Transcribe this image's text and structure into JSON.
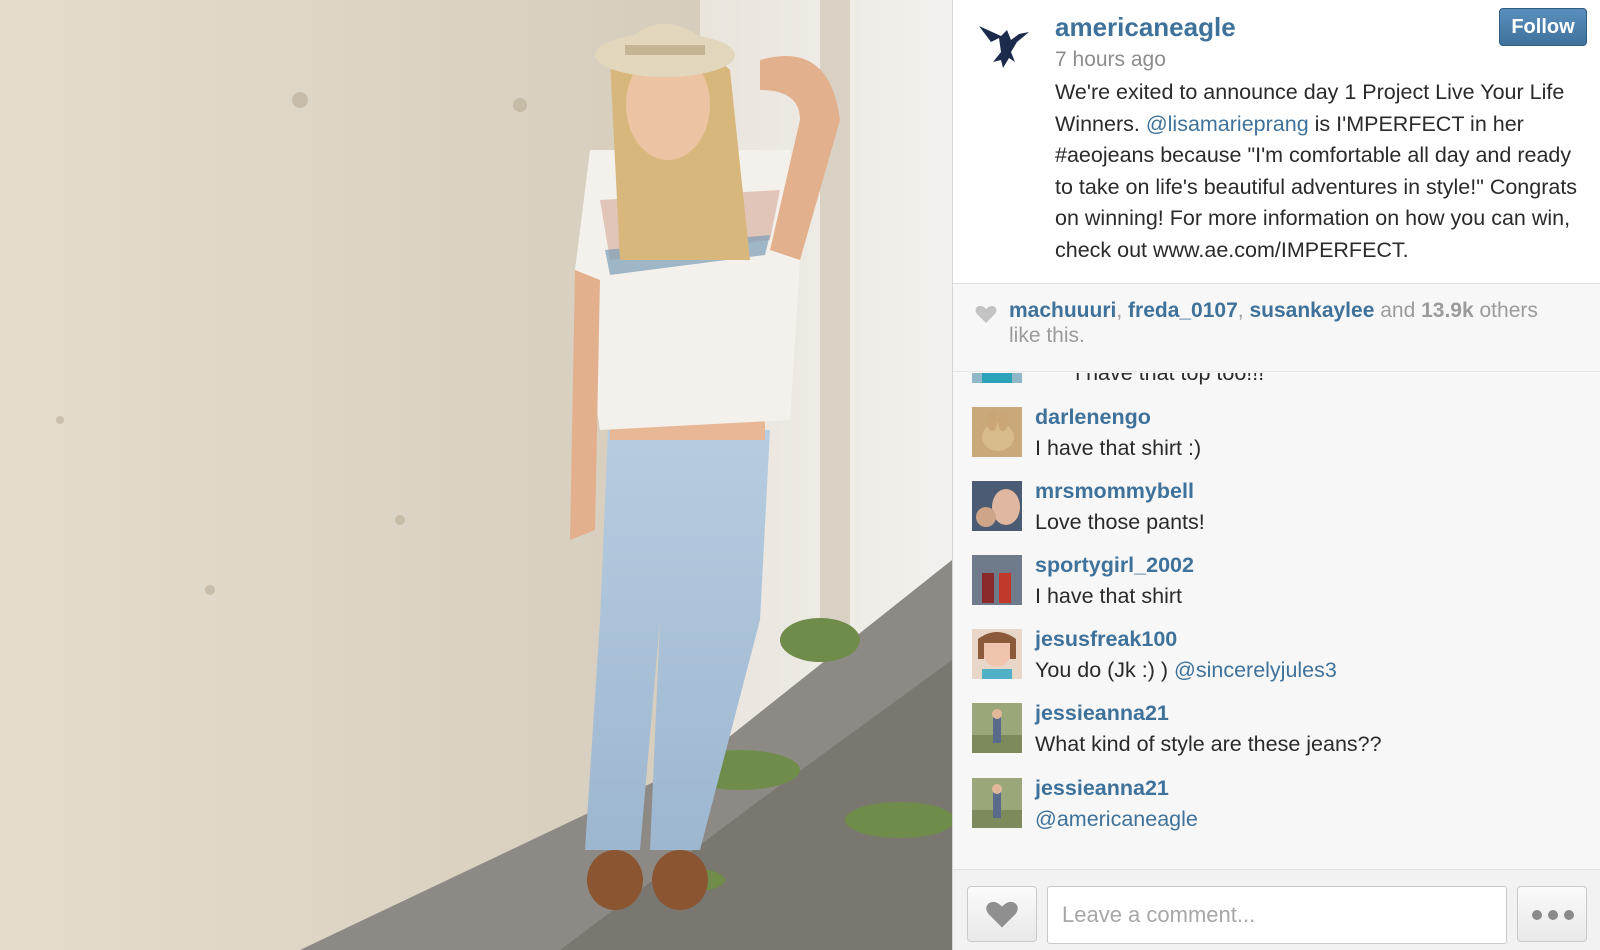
{
  "photo": {
    "alt_subject": "woman-in-jeans-against-wall"
  },
  "post": {
    "author": "americaneagle",
    "follow_label": "Follow",
    "time": "7 hours ago",
    "caption_parts": {
      "before": "We're exited to announce day 1 Project Live Your Life Winners. ",
      "mention": "@lisamarieprang",
      "after": " is I'MPERFECT in her #aeojeans because \"I'm comfortable all day and ready to take on life's beautiful adventures in style!\" Congrats on winning! For more information on how you can win, check out www.ae.com/IMPERFECT."
    }
  },
  "likes": {
    "users": [
      "machuuuri",
      "freda_0107",
      "susankaylee"
    ],
    "sep1": ", ",
    "sep2": ", ",
    "and_text": " and ",
    "count": "13.9k",
    "suffix": " others like this."
  },
  "comments": {
    "partial_text": "^^^^i have that top too!!!",
    "items": [
      {
        "user": "darlenengo",
        "text": "I have that shirt :)",
        "mention": ""
      },
      {
        "user": "mrsmommybell",
        "text": "Love those pants!",
        "mention": ""
      },
      {
        "user": "sportygirl_2002",
        "text": "I have that shirt",
        "mention": ""
      },
      {
        "user": "jesusfreak100",
        "text": "You do (Jk :) ) ",
        "mention": "@sincerelyjules3"
      },
      {
        "user": "jessieanna21",
        "text": "What kind of style are these jeans??",
        "mention": ""
      },
      {
        "user": "jessieanna21",
        "text": "",
        "mention": "@americaneagle"
      }
    ]
  },
  "footer": {
    "comment_placeholder": "Leave a comment..."
  },
  "icons": {
    "like": "heart-icon",
    "more": "more-dots-icon",
    "avatar": "eagle-logo"
  },
  "colors": {
    "link": "#3f729b",
    "text": "#2a2a2a",
    "muted": "#9b9b9b"
  }
}
